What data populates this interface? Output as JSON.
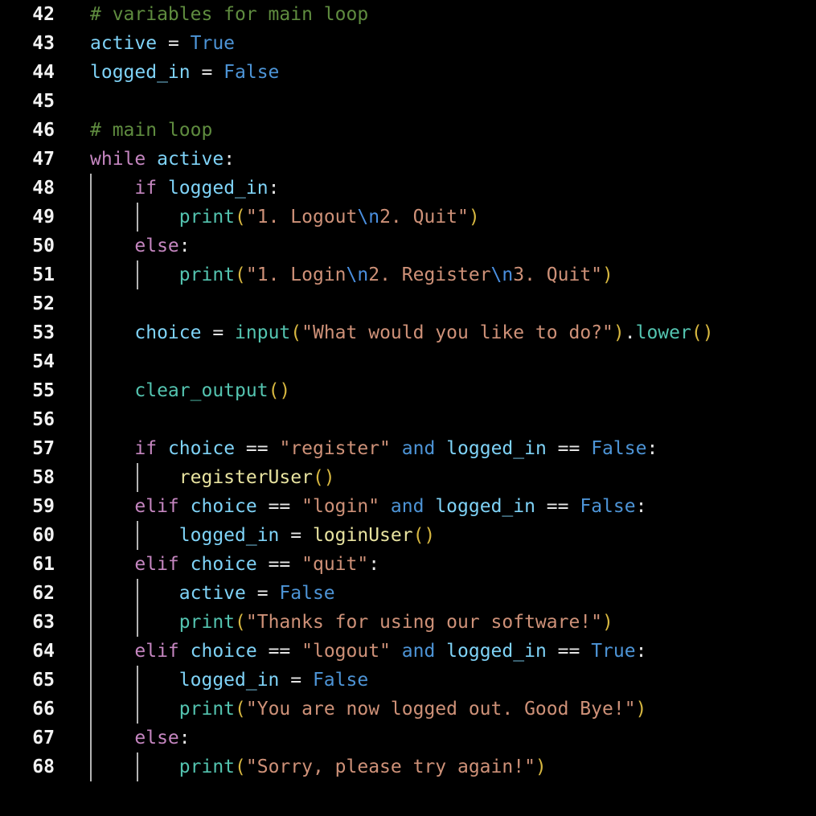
{
  "editor": {
    "language": "python",
    "background_color": "#000000",
    "font_size_px": 23,
    "line_height_px": 36,
    "first_line_number": 42,
    "last_line_number": 68,
    "colors": {
      "background": "#000000",
      "line_number": "#f2f2f2",
      "indent_guide": "#b4b4b4",
      "comment": "#5f8c3f",
      "keyword": "#c586c0",
      "operator_keyword": "#4d94d6",
      "constant": "#4d94d6",
      "variable": "#7fd3f7",
      "builtin_function": "#54c4b0",
      "user_function": "#e8e3a0",
      "parenthesis": "#d7b740",
      "string": "#ce9178",
      "escape_sequence": "#4a8fe0",
      "punctuation": "#e6e6e6"
    },
    "lines": [
      {
        "number": "42",
        "guides": 0,
        "tokens": [
          {
            "text": "# variables for main loop",
            "type": "comment"
          }
        ]
      },
      {
        "number": "43",
        "guides": 0,
        "tokens": [
          {
            "text": "active",
            "type": "var"
          },
          {
            "text": " = ",
            "type": "punct"
          },
          {
            "text": "True",
            "type": "const"
          }
        ]
      },
      {
        "number": "44",
        "guides": 0,
        "tokens": [
          {
            "text": "logged_in",
            "type": "var"
          },
          {
            "text": " = ",
            "type": "punct"
          },
          {
            "text": "False",
            "type": "const"
          }
        ]
      },
      {
        "number": "45",
        "guides": 0,
        "tokens": []
      },
      {
        "number": "46",
        "guides": 0,
        "tokens": [
          {
            "text": "# main loop",
            "type": "comment"
          }
        ]
      },
      {
        "number": "47",
        "guides": 0,
        "tokens": [
          {
            "text": "while",
            "type": "keyword"
          },
          {
            "text": " ",
            "type": "plain"
          },
          {
            "text": "active",
            "type": "var"
          },
          {
            "text": ":",
            "type": "punct"
          }
        ]
      },
      {
        "number": "48",
        "guides": 1,
        "tokens": [
          {
            "text": "    ",
            "type": "plain"
          },
          {
            "text": "if",
            "type": "keyword"
          },
          {
            "text": " ",
            "type": "plain"
          },
          {
            "text": "logged_in",
            "type": "var"
          },
          {
            "text": ":",
            "type": "punct"
          }
        ]
      },
      {
        "number": "49",
        "guides": 2,
        "tokens": [
          {
            "text": "        ",
            "type": "plain"
          },
          {
            "text": "print",
            "type": "builtin"
          },
          {
            "text": "(",
            "type": "paren"
          },
          {
            "text": "\"1. Logout",
            "type": "string"
          },
          {
            "text": "\\n",
            "type": "escape"
          },
          {
            "text": "2. Quit\"",
            "type": "string"
          },
          {
            "text": ")",
            "type": "paren"
          }
        ]
      },
      {
        "number": "50",
        "guides": 1,
        "tokens": [
          {
            "text": "    ",
            "type": "plain"
          },
          {
            "text": "else",
            "type": "keyword"
          },
          {
            "text": ":",
            "type": "punct"
          }
        ]
      },
      {
        "number": "51",
        "guides": 2,
        "tokens": [
          {
            "text": "        ",
            "type": "plain"
          },
          {
            "text": "print",
            "type": "builtin"
          },
          {
            "text": "(",
            "type": "paren"
          },
          {
            "text": "\"1. Login",
            "type": "string"
          },
          {
            "text": "\\n",
            "type": "escape"
          },
          {
            "text": "2. Register",
            "type": "string"
          },
          {
            "text": "\\n",
            "type": "escape"
          },
          {
            "text": "3. Quit\"",
            "type": "string"
          },
          {
            "text": ")",
            "type": "paren"
          }
        ]
      },
      {
        "number": "52",
        "guides": 1,
        "tokens": []
      },
      {
        "number": "53",
        "guides": 1,
        "tokens": [
          {
            "text": "    ",
            "type": "plain"
          },
          {
            "text": "choice",
            "type": "var"
          },
          {
            "text": " = ",
            "type": "punct"
          },
          {
            "text": "input",
            "type": "builtin"
          },
          {
            "text": "(",
            "type": "paren"
          },
          {
            "text": "\"What would you like to do?\"",
            "type": "string"
          },
          {
            "text": ")",
            "type": "paren"
          },
          {
            "text": ".",
            "type": "punct"
          },
          {
            "text": "lower",
            "type": "builtin"
          },
          {
            "text": "()",
            "type": "paren"
          }
        ]
      },
      {
        "number": "54",
        "guides": 1,
        "tokens": []
      },
      {
        "number": "55",
        "guides": 1,
        "tokens": [
          {
            "text": "    ",
            "type": "plain"
          },
          {
            "text": "clear_output",
            "type": "builtin"
          },
          {
            "text": "()",
            "type": "paren"
          }
        ]
      },
      {
        "number": "56",
        "guides": 1,
        "tokens": []
      },
      {
        "number": "57",
        "guides": 1,
        "tokens": [
          {
            "text": "    ",
            "type": "plain"
          },
          {
            "text": "if",
            "type": "keyword"
          },
          {
            "text": " ",
            "type": "plain"
          },
          {
            "text": "choice",
            "type": "var"
          },
          {
            "text": " == ",
            "type": "punct"
          },
          {
            "text": "\"register\"",
            "type": "string"
          },
          {
            "text": " ",
            "type": "plain"
          },
          {
            "text": "and",
            "type": "operator-kw"
          },
          {
            "text": " ",
            "type": "plain"
          },
          {
            "text": "logged_in",
            "type": "var"
          },
          {
            "text": " == ",
            "type": "punct"
          },
          {
            "text": "False",
            "type": "const"
          },
          {
            "text": ":",
            "type": "punct"
          }
        ]
      },
      {
        "number": "58",
        "guides": 2,
        "tokens": [
          {
            "text": "        ",
            "type": "plain"
          },
          {
            "text": "registerUser",
            "type": "func"
          },
          {
            "text": "()",
            "type": "paren"
          }
        ]
      },
      {
        "number": "59",
        "guides": 1,
        "tokens": [
          {
            "text": "    ",
            "type": "plain"
          },
          {
            "text": "elif",
            "type": "keyword"
          },
          {
            "text": " ",
            "type": "plain"
          },
          {
            "text": "choice",
            "type": "var"
          },
          {
            "text": " == ",
            "type": "punct"
          },
          {
            "text": "\"login\"",
            "type": "string"
          },
          {
            "text": " ",
            "type": "plain"
          },
          {
            "text": "and",
            "type": "operator-kw"
          },
          {
            "text": " ",
            "type": "plain"
          },
          {
            "text": "logged_in",
            "type": "var"
          },
          {
            "text": " == ",
            "type": "punct"
          },
          {
            "text": "False",
            "type": "const"
          },
          {
            "text": ":",
            "type": "punct"
          }
        ]
      },
      {
        "number": "60",
        "guides": 2,
        "tokens": [
          {
            "text": "        ",
            "type": "plain"
          },
          {
            "text": "logged_in",
            "type": "var"
          },
          {
            "text": " = ",
            "type": "punct"
          },
          {
            "text": "loginUser",
            "type": "func"
          },
          {
            "text": "()",
            "type": "paren"
          }
        ]
      },
      {
        "number": "61",
        "guides": 1,
        "tokens": [
          {
            "text": "    ",
            "type": "plain"
          },
          {
            "text": "elif",
            "type": "keyword"
          },
          {
            "text": " ",
            "type": "plain"
          },
          {
            "text": "choice",
            "type": "var"
          },
          {
            "text": " == ",
            "type": "punct"
          },
          {
            "text": "\"quit\"",
            "type": "string"
          },
          {
            "text": ":",
            "type": "punct"
          }
        ]
      },
      {
        "number": "62",
        "guides": 2,
        "tokens": [
          {
            "text": "        ",
            "type": "plain"
          },
          {
            "text": "active",
            "type": "var"
          },
          {
            "text": " = ",
            "type": "punct"
          },
          {
            "text": "False",
            "type": "const"
          }
        ]
      },
      {
        "number": "63",
        "guides": 2,
        "tokens": [
          {
            "text": "        ",
            "type": "plain"
          },
          {
            "text": "print",
            "type": "builtin"
          },
          {
            "text": "(",
            "type": "paren"
          },
          {
            "text": "\"Thanks for using our software!\"",
            "type": "string"
          },
          {
            "text": ")",
            "type": "paren"
          }
        ]
      },
      {
        "number": "64",
        "guides": 1,
        "tokens": [
          {
            "text": "    ",
            "type": "plain"
          },
          {
            "text": "elif",
            "type": "keyword"
          },
          {
            "text": " ",
            "type": "plain"
          },
          {
            "text": "choice",
            "type": "var"
          },
          {
            "text": " == ",
            "type": "punct"
          },
          {
            "text": "\"logout\"",
            "type": "string"
          },
          {
            "text": " ",
            "type": "plain"
          },
          {
            "text": "and",
            "type": "operator-kw"
          },
          {
            "text": " ",
            "type": "plain"
          },
          {
            "text": "logged_in",
            "type": "var"
          },
          {
            "text": " == ",
            "type": "punct"
          },
          {
            "text": "True",
            "type": "const"
          },
          {
            "text": ":",
            "type": "punct"
          }
        ]
      },
      {
        "number": "65",
        "guides": 2,
        "tokens": [
          {
            "text": "        ",
            "type": "plain"
          },
          {
            "text": "logged_in",
            "type": "var"
          },
          {
            "text": " = ",
            "type": "punct"
          },
          {
            "text": "False",
            "type": "const"
          }
        ]
      },
      {
        "number": "66",
        "guides": 2,
        "tokens": [
          {
            "text": "        ",
            "type": "plain"
          },
          {
            "text": "print",
            "type": "builtin"
          },
          {
            "text": "(",
            "type": "paren"
          },
          {
            "text": "\"You are now logged out. Good Bye!\"",
            "type": "string"
          },
          {
            "text": ")",
            "type": "paren"
          }
        ]
      },
      {
        "number": "67",
        "guides": 1,
        "tokens": [
          {
            "text": "    ",
            "type": "plain"
          },
          {
            "text": "else",
            "type": "keyword"
          },
          {
            "text": ":",
            "type": "punct"
          }
        ]
      },
      {
        "number": "68",
        "guides": 2,
        "tokens": [
          {
            "text": "        ",
            "type": "plain"
          },
          {
            "text": "print",
            "type": "builtin"
          },
          {
            "text": "(",
            "type": "paren"
          },
          {
            "text": "\"Sorry, please try again!\"",
            "type": "string"
          },
          {
            "text": ")",
            "type": "paren"
          }
        ]
      }
    ]
  }
}
